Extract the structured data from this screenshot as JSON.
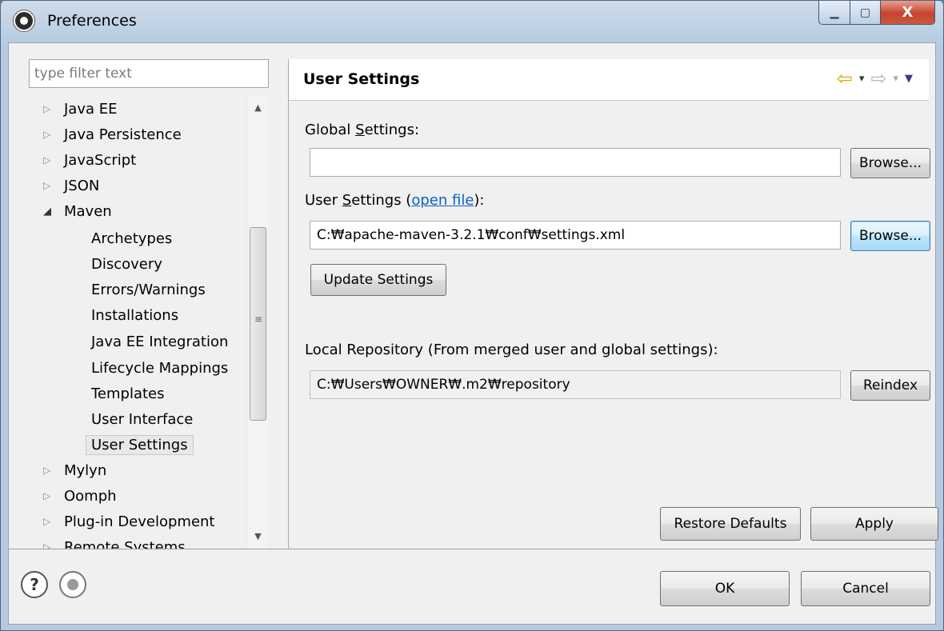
{
  "window": {
    "title": "Preferences",
    "controls": {
      "minimize": "▁",
      "maximize": "▢",
      "close": "X"
    }
  },
  "filter": {
    "placeholder": "type filter text"
  },
  "tree": {
    "items": [
      {
        "label": "Java EE",
        "arrow": "▷"
      },
      {
        "label": "Java Persistence",
        "arrow": "▷"
      },
      {
        "label": "JavaScript",
        "arrow": "▷"
      },
      {
        "label": "JSON",
        "arrow": "▷"
      },
      {
        "label": "Maven",
        "arrow": "◢"
      },
      {
        "label": "Archetypes"
      },
      {
        "label": "Discovery"
      },
      {
        "label": "Errors/Warnings"
      },
      {
        "label": "Installations"
      },
      {
        "label": "Java EE Integration"
      },
      {
        "label": "Lifecycle Mappings"
      },
      {
        "label": "Templates"
      },
      {
        "label": "User Interface"
      },
      {
        "label": "User Settings",
        "selected": true
      },
      {
        "label": "Mylyn",
        "arrow": "▷"
      },
      {
        "label": "Oomph",
        "arrow": "▷"
      },
      {
        "label": "Plug-in Development",
        "arrow": "▷"
      },
      {
        "label": "Remote Systems",
        "arrow": "▷"
      }
    ],
    "scroll": {
      "up": "▲",
      "down": "▼",
      "grip": "≡"
    }
  },
  "page": {
    "title": "User Settings",
    "nav": {
      "back": "⇦",
      "back_dd": "▾",
      "forward": "⇨",
      "forward_dd": "▾",
      "menu": "▼"
    },
    "global_label_pre": "Global ",
    "global_label_ul": "S",
    "global_label_post": "ettings:",
    "global_value": "",
    "browse_label": "Browse...",
    "user_label_pre": "User ",
    "user_label_ul": "S",
    "user_label_post": "ettings (",
    "open_file": "open file",
    "user_label_end": "):",
    "user_value": "C:₩apache-maven-3.2.1₩conf₩settings.xml",
    "update_label": "Update Settings",
    "local_label": "Local Repository (From merged user and global settings):",
    "local_value": "C:₩Users₩OWNER₩.m2₩repository",
    "reindex_label": "Reindex",
    "restore_label": "Restore Defaults",
    "apply_label": "Apply"
  },
  "footer": {
    "help": "?",
    "ok_label": "OK",
    "cancel_label": "Cancel"
  }
}
